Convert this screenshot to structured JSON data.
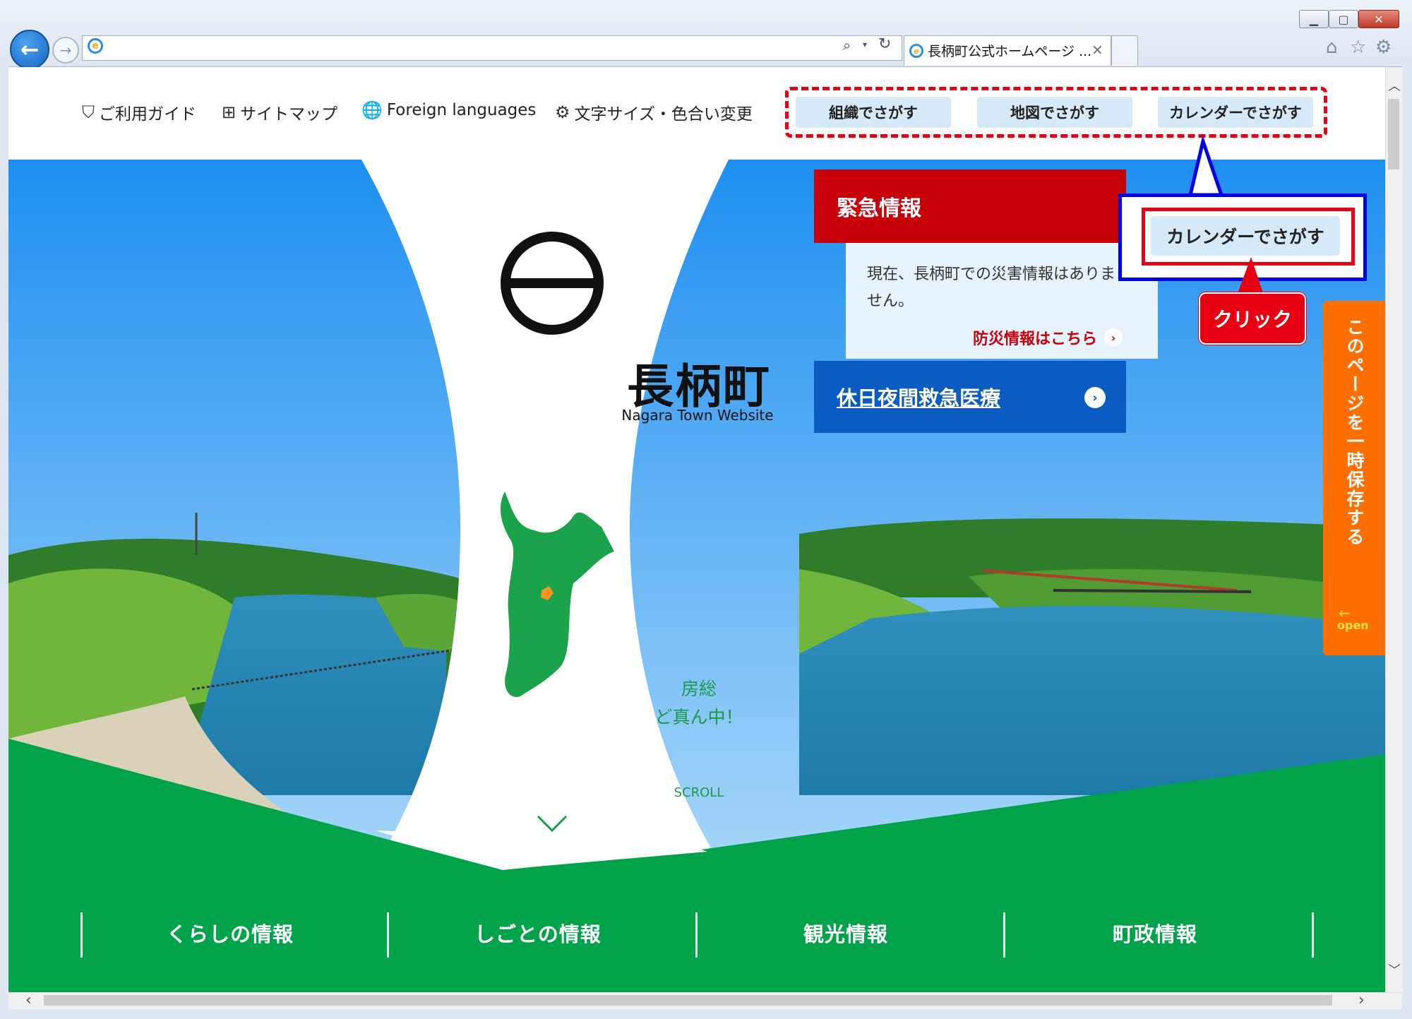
{
  "browser": {
    "tab_title": "長柄町公式ホームページ ...",
    "tab_close": "×",
    "address_value": "",
    "window_controls": {
      "minimize": "▁",
      "maximize": "▢",
      "close": "✕"
    },
    "icons": {
      "back": "←",
      "forward": "→",
      "search": "⌕",
      "dropdown": "▾",
      "refresh": "↻",
      "home": "⌂",
      "favorites": "☆",
      "settings": "⚙",
      "ie": "e"
    }
  },
  "header": {
    "links": [
      {
        "icon": "shield-icon",
        "glyph": "⛉",
        "label": "ご利用ガイド"
      },
      {
        "icon": "sitemap-icon",
        "glyph": "⊞",
        "label": "サイトマップ"
      },
      {
        "icon": "globe-icon",
        "glyph": "🌐",
        "label": "Foreign languages"
      },
      {
        "icon": "settings-icon",
        "glyph": "⚙",
        "label": "文字サイズ・色合い変更"
      }
    ],
    "search_buttons": [
      "組織でさがす",
      "地図でさがす",
      "カレンダーでさがす"
    ]
  },
  "emergency": {
    "title": "緊急情報",
    "message": "現在、長柄町での災害情報はありません。",
    "link": "防災情報はこちら",
    "link_arrow": "›"
  },
  "holiday": {
    "label": "休日夜間救急医療",
    "arrow": "›"
  },
  "logo": {
    "name": "長柄町",
    "subtitle": "Nagara Town Website"
  },
  "map": {
    "line1": "房総",
    "line2": "ど真ん中！"
  },
  "scroll": {
    "label": "SCROLL"
  },
  "bottom_nav": [
    "くらしの情報",
    "しごとの情報",
    "観光情報",
    "町政情報"
  ],
  "save_tab": {
    "label": "このページを一時保存する",
    "open": "open",
    "arrow": "←"
  },
  "annotation": {
    "button_label": "カレンダーでさがす",
    "click_label": "クリック"
  },
  "scrollbars": {
    "up": "︿",
    "down": "﹀",
    "left": "‹",
    "right": "›"
  },
  "colors": {
    "accent_green": "#00a24a",
    "emergency_red": "#c8000a",
    "holiday_blue": "#0a5cc2",
    "save_orange": "#ff6f00",
    "button_blue": "#d6e9f8",
    "annotation_red": "#e60012",
    "annotation_blue": "#0000e6"
  }
}
